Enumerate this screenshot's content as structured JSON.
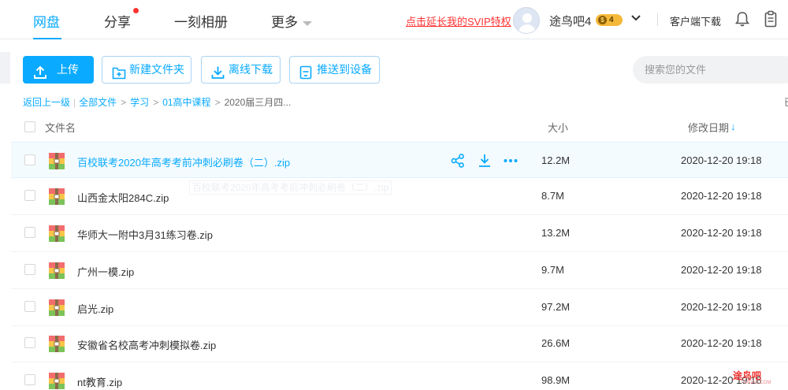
{
  "nav": {
    "items": [
      "网盘",
      "分享",
      "一刻相册",
      "更多"
    ],
    "svip_link": "点击延长我的SVIP特权",
    "username": "途鸟吧4",
    "svip_level": "4",
    "coin_symbol": "$",
    "client_download": "客户端下载",
    "icons": [
      "bell-icon",
      "clipboard-icon",
      "user-chevron-icon",
      "more-caret-icon"
    ]
  },
  "toolbar": {
    "upload": "上传",
    "new_folder": "新建文件夹",
    "offline_download": "离线下载",
    "push_to_device": "推送到设备",
    "search_placeholder": "搜索您的文件"
  },
  "breadcrumb": {
    "back": "返回上一级",
    "all_files": "全部文件",
    "crumbs": [
      "学习",
      "01高中课程"
    ],
    "current": "2020届三月四...",
    "edge_glyph": "已"
  },
  "table": {
    "headers": {
      "name": "文件名",
      "size": "大小",
      "date": "修改日期"
    },
    "sort_arrow": "↓",
    "rows": [
      {
        "name": "百校联考2020年高考考前冲刺必刷卷（二）.zip",
        "size": "12.2M",
        "date": "2020-12-20 19:18"
      },
      {
        "name": "山西金太阳284C.zip",
        "size": "8.7M",
        "date": "2020-12-20 19:18"
      },
      {
        "name": "华师大一附中3月31练习卷.zip",
        "size": "13.2M",
        "date": "2020-12-20 19:18"
      },
      {
        "name": "广州一模.zip",
        "size": "9.7M",
        "date": "2020-12-20 19:18"
      },
      {
        "name": "启光.zip",
        "size": "97.2M",
        "date": "2020-12-20 19:18"
      },
      {
        "name": "安徽省名校高考冲刺模拟卷.zip",
        "size": "26.6M",
        "date": "2020-12-20 19:18"
      },
      {
        "name": "nt教育.zip",
        "size": "98.9M",
        "date": "2020-12-20 19:18"
      }
    ],
    "hover_tooltip": "百校联考2020年高考考前冲刺必刷卷（二）.zip"
  },
  "watermark": {
    "text": "途鸟吧",
    "sub": "TUNIAO.COM"
  },
  "colors": {
    "accent": "#09aaff",
    "svip_red": "#ff3333",
    "badge_gold": "#f5b93a"
  }
}
